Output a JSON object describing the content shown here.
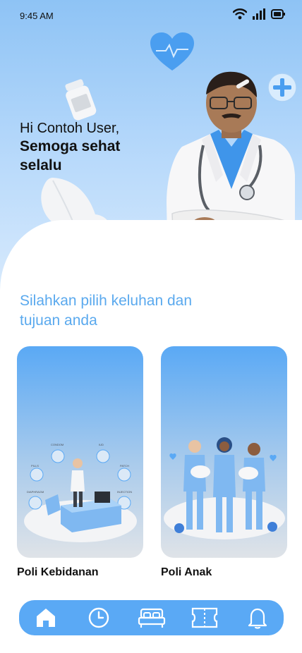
{
  "status": {
    "time": "9:45 AM",
    "icons": [
      "wifi-icon",
      "signal-icon",
      "battery-icon"
    ]
  },
  "greeting": {
    "hi": "Hi Contoh User,",
    "wish": "Semoga sehat selalu"
  },
  "prompt": "Silahkan pilih keluhan dan tujuan anda",
  "cards": [
    {
      "label": "Poli Kebidanan",
      "illustration": "doctor-workstation-illustration",
      "illustration_labels": [
        "CONDOM",
        "IUD",
        "PILLS",
        "PATCH",
        "DIAPHRAGM",
        "INJECTION"
      ]
    },
    {
      "label": "Poli Anak",
      "illustration": "nurses-with-babies-illustration"
    }
  ],
  "nav": {
    "items": [
      "home-icon",
      "history-icon",
      "bed-icon",
      "ticket-icon",
      "notification-icon"
    ],
    "active": "home-icon"
  },
  "colors": {
    "accent": "#5aa9f5",
    "prompt_text": "#5aa9ee",
    "hero_top": "#8ec3f5"
  }
}
